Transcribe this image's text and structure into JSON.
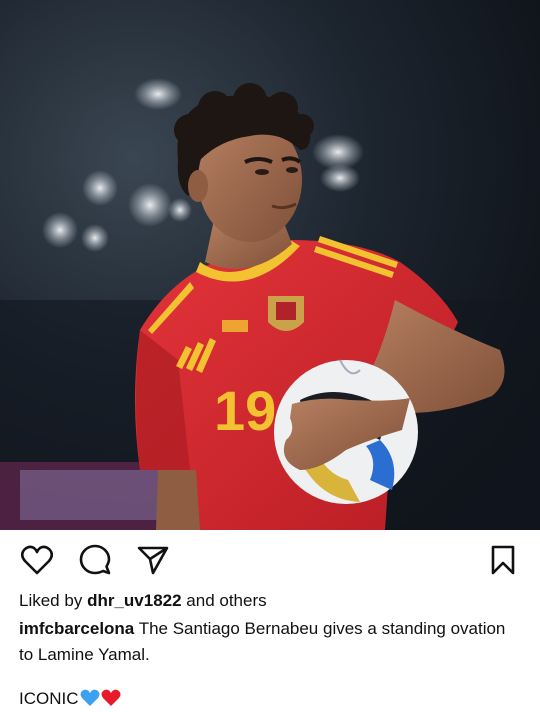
{
  "post": {
    "image": {
      "subject": "player-in-red-jersey",
      "shirt_number": "19",
      "colors": {
        "jersey": "#d6262a",
        "trim": "#f2c230",
        "background": "#141a22"
      }
    },
    "actions": {
      "like_icon": "heart-outline-icon",
      "comment_icon": "speech-bubble-icon",
      "share_icon": "paper-plane-icon",
      "save_icon": "bookmark-icon"
    },
    "likes": {
      "prefix": "Liked by",
      "user": "dhr_uv1822",
      "suffix": "and others"
    },
    "caption": {
      "user": "imfcbarcelona",
      "text": "The Santiago Bernabeu gives a standing ovation to Lamine Yamal."
    },
    "extra_line": {
      "text": "ICONIC",
      "emojis": [
        "blue-heart-icon",
        "red-heart-icon"
      ],
      "emoji_colors": {
        "blue": "#3ba1f0",
        "red": "#e81b2d"
      }
    }
  }
}
